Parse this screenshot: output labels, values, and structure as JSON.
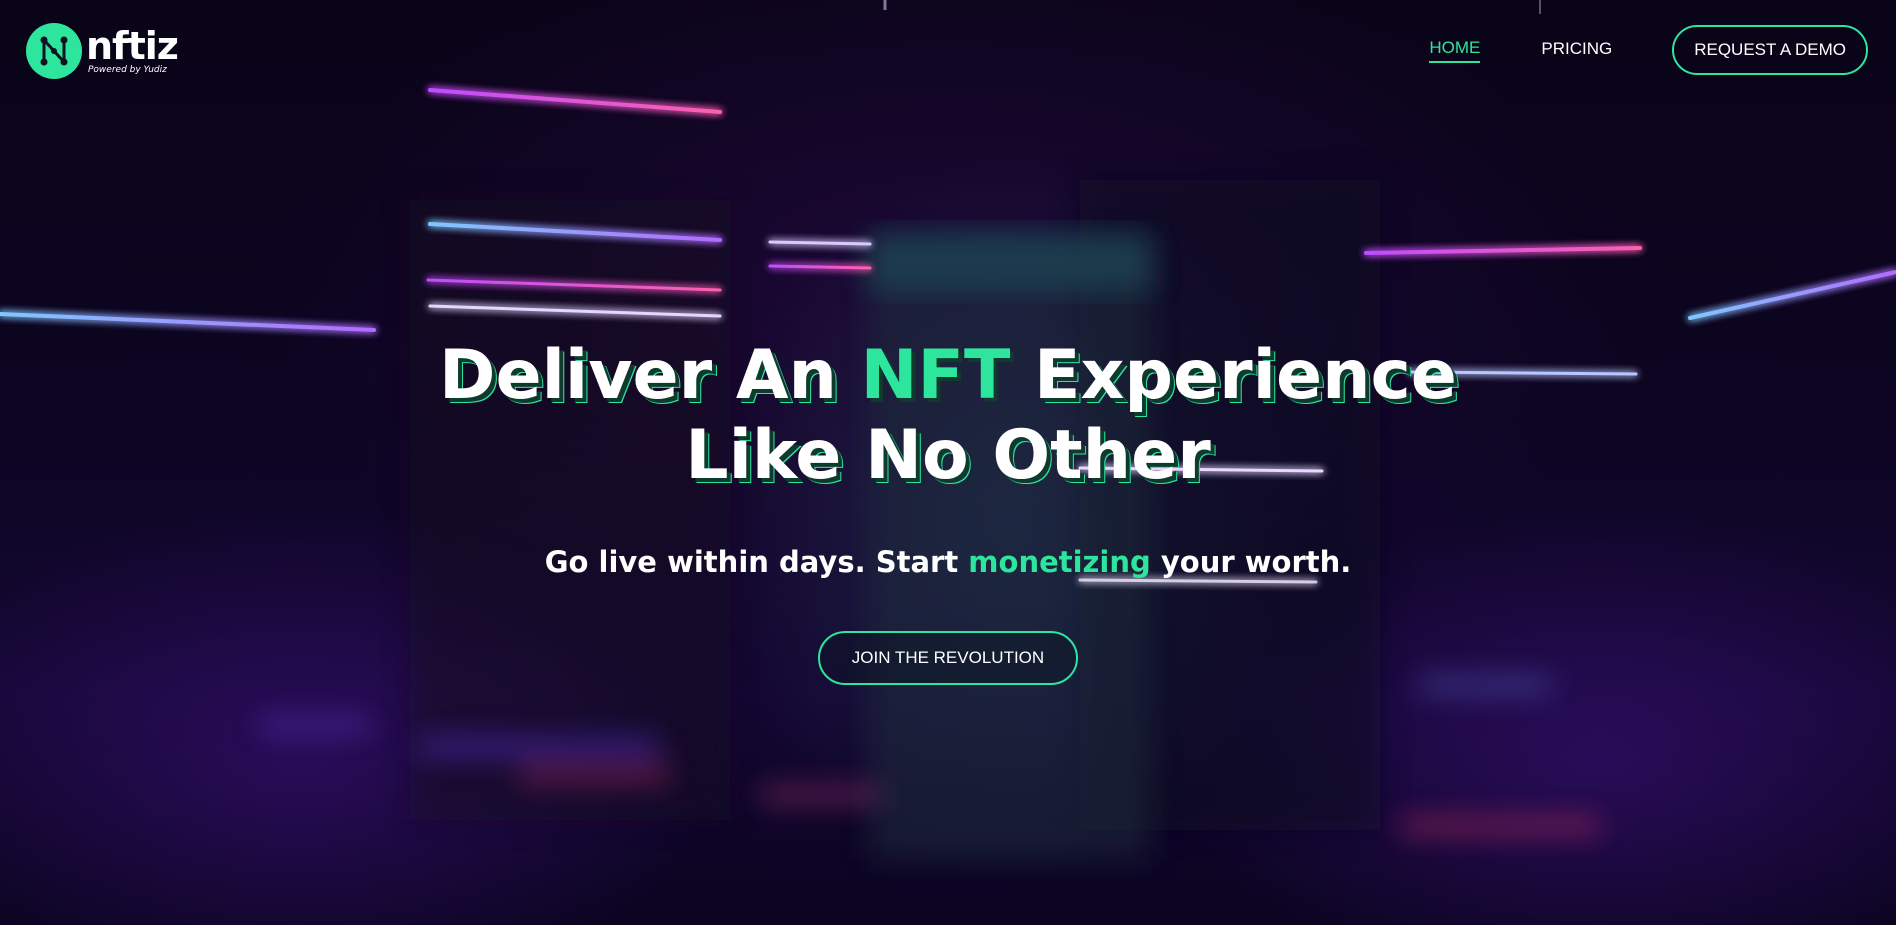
{
  "brand": {
    "name": "nftiz",
    "tagline": "Powered by Yudiz",
    "accent_color": "#2ee59d",
    "logo_icon": "network-n-icon"
  },
  "nav": {
    "items": [
      {
        "label": "HOME",
        "active": true
      },
      {
        "label": "PRICING",
        "active": false
      }
    ],
    "cta_label": "REQUEST A DEMO"
  },
  "hero": {
    "headline": {
      "part1": "Deliver An ",
      "highlight": "NFT",
      "part2": " Experience",
      "line2": "Like No Other"
    },
    "subheadline": {
      "part1": "Go live within days. Start ",
      "highlight": "monetizing",
      "part2": " your worth."
    },
    "cta_label": "JOIN THE REVOLUTION"
  }
}
